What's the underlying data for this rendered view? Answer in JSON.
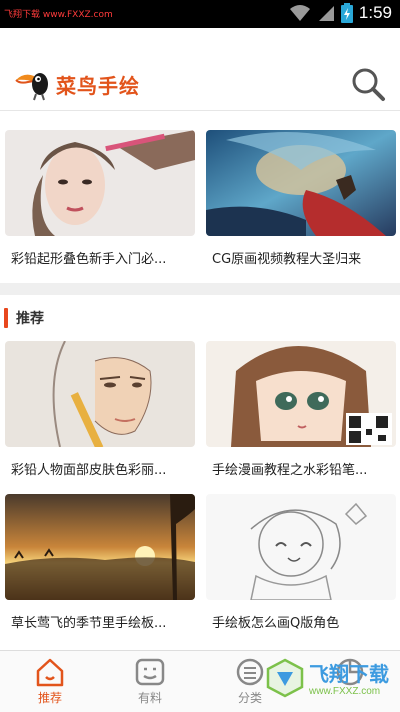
{
  "status_bar": {
    "watermark": "飞翔下载 www.FXXZ.com",
    "time": "1:59"
  },
  "app": {
    "logo_text": "菜鸟手绘",
    "brand_color": "#e2541b"
  },
  "top_cards": [
    {
      "title": "彩铅起形叠色新手入门必..."
    },
    {
      "title": "CG原画视频教程大圣归来"
    }
  ],
  "recommend": {
    "section_title": "推荐",
    "cards": [
      {
        "title": "彩铅人物面部皮肤色彩丽..."
      },
      {
        "title": "手绘漫画教程之水彩铅笔..."
      },
      {
        "title": "草长莺飞的季节里手绘板..."
      },
      {
        "title": "手绘板怎么画Q版角色"
      }
    ]
  },
  "tabs": [
    {
      "label": "推荐",
      "icon": "home-icon",
      "active": true
    },
    {
      "label": "有料",
      "icon": "smile-box-icon",
      "active": false
    },
    {
      "label": "分类",
      "icon": "list-icon",
      "active": false
    },
    {
      "label": "",
      "icon": "pie-icon",
      "active": false
    }
  ],
  "watermark_logo": {
    "text": "飞翔下载",
    "url": "www.FXXZ.com"
  }
}
